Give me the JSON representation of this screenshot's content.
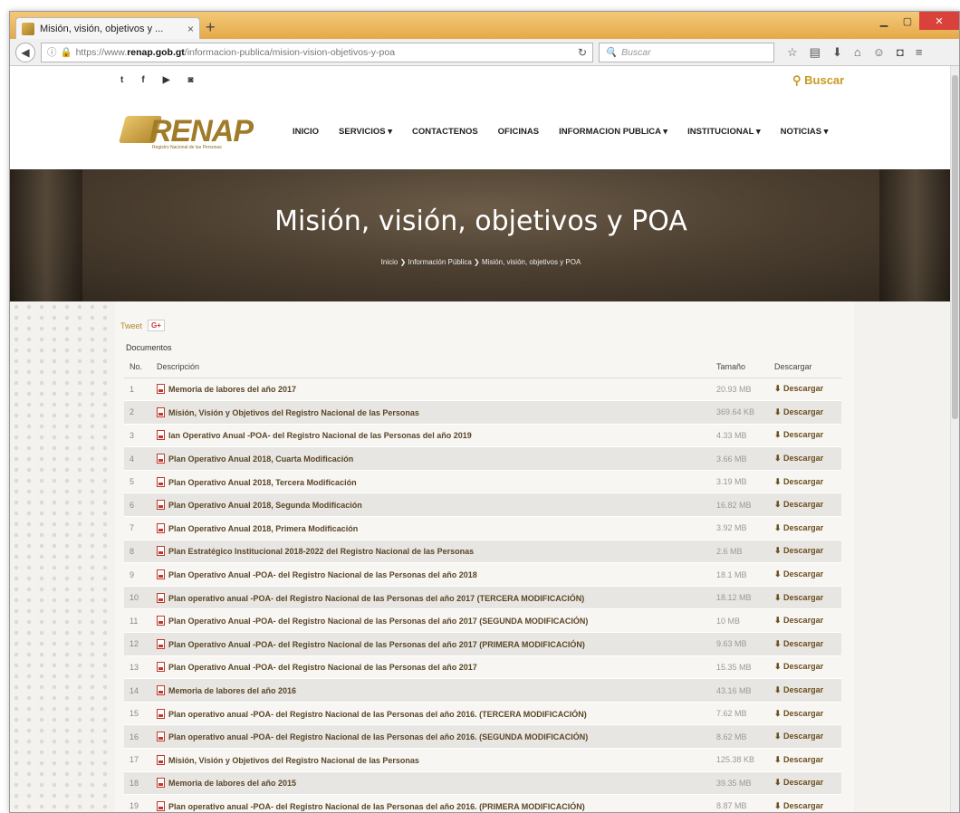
{
  "browser": {
    "tab_title": "Misión, visión, objetivos y ...",
    "tab_close": "×",
    "new_tab": "+",
    "url_prefix": "https://www.",
    "url_host": "renap.gob.gt",
    "url_path": "/informacion-publica/mision-vision-objetivos-y-poa",
    "search_placeholder": "Buscar"
  },
  "top": {
    "social_icons": [
      "twitter-icon",
      "facebook-icon",
      "youtube-icon",
      "instagram-icon"
    ],
    "search_label": "Buscar"
  },
  "logo": {
    "text": "RENAP",
    "subtitle": "Registro Nacional de las Personas"
  },
  "menu": [
    {
      "label": "INICIO"
    },
    {
      "label": "SERVICIOS ▾"
    },
    {
      "label": "CONTACTENOS"
    },
    {
      "label": "OFICINAS"
    },
    {
      "label": "INFORMACION PUBLICA ▾"
    },
    {
      "label": "INSTITUCIONAL ▾"
    },
    {
      "label": "NOTICIAS ▾"
    }
  ],
  "hero": {
    "title": "Misión, visión, objetivos y POA",
    "breadcrumb": [
      "Inicio",
      "Información Pública",
      "Misión, visión, objetivos y POA"
    ]
  },
  "share": {
    "tweet": "Tweet",
    "gplus": "G+"
  },
  "documents": {
    "label": "Documentos",
    "headers": {
      "no": "No.",
      "desc": "Descripción",
      "size": "Tamaño",
      "dl": "Descargar"
    },
    "download_label": "⬇ Descargar",
    "rows": [
      {
        "no": "1",
        "desc": "Memoria de labores del año 2017",
        "size": "20.93 MB"
      },
      {
        "no": "2",
        "desc": "Misión, Visión y Objetivos del Registro Nacional de las Personas",
        "size": "369.64 KB"
      },
      {
        "no": "3",
        "desc": "lan Operativo Anual -POA- del Registro Nacional de las Personas del año 2019",
        "size": "4.33 MB"
      },
      {
        "no": "4",
        "desc": "Plan Operativo Anual 2018, Cuarta Modificación",
        "size": "3.66 MB"
      },
      {
        "no": "5",
        "desc": "Plan Operativo Anual 2018, Tercera Modificación",
        "size": "3.19 MB"
      },
      {
        "no": "6",
        "desc": "Plan Operativo Anual 2018, Segunda Modificación",
        "size": "16.82 MB"
      },
      {
        "no": "7",
        "desc": "Plan Operativo Anual 2018, Primera Modificación",
        "size": "3.92 MB"
      },
      {
        "no": "8",
        "desc": "Plan Estratégico Institucional 2018-2022 del Registro Nacional de las Personas",
        "size": "2.6 MB"
      },
      {
        "no": "9",
        "desc": "Plan Operativo Anual -POA- del Registro Nacional de las Personas del año 2018",
        "size": "18.1 MB"
      },
      {
        "no": "10",
        "desc": "Plan operativo anual -POA- del Registro Nacional de las Personas del año 2017 (TERCERA MODIFICACIÓN)",
        "size": "18.12 MB"
      },
      {
        "no": "11",
        "desc": "Plan Operativo Anual -POA- del Registro Nacional de las Personas del año 2017 (SEGUNDA MODIFICACIÓN)",
        "size": "10 MB"
      },
      {
        "no": "12",
        "desc": "Plan Operativo Anual -POA- del Registro Nacional de las Personas del año 2017 (PRIMERA MODIFICACIÓN)",
        "size": "9.63 MB"
      },
      {
        "no": "13",
        "desc": "Plan Operativo Anual -POA- del Registro Nacional de las Personas del año 2017",
        "size": "15.35 MB"
      },
      {
        "no": "14",
        "desc": "Memoria de labores del año 2016",
        "size": "43.16 MB"
      },
      {
        "no": "15",
        "desc": "Plan operativo anual -POA- del Registro Nacional de las Personas del año 2016. (TERCERA MODIFICACIÓN)",
        "size": "7.62 MB"
      },
      {
        "no": "16",
        "desc": "Plan operativo anual -POA- del Registro Nacional de las Personas del año 2016. (SEGUNDA MODIFICACIÓN)",
        "size": "8.62 MB"
      },
      {
        "no": "17",
        "desc": "Misión, Visión y Objetivos del Registro Nacional de las Personas",
        "size": "125.38 KB"
      },
      {
        "no": "18",
        "desc": "Memoria de labores del año 2015",
        "size": "39.35 MB"
      },
      {
        "no": "19",
        "desc": "Plan operativo anual -POA- del Registro Nacional de las Personas del año 2016. (PRIMERA MODIFICACIÓN)",
        "size": "8.87 MB"
      }
    ]
  }
}
